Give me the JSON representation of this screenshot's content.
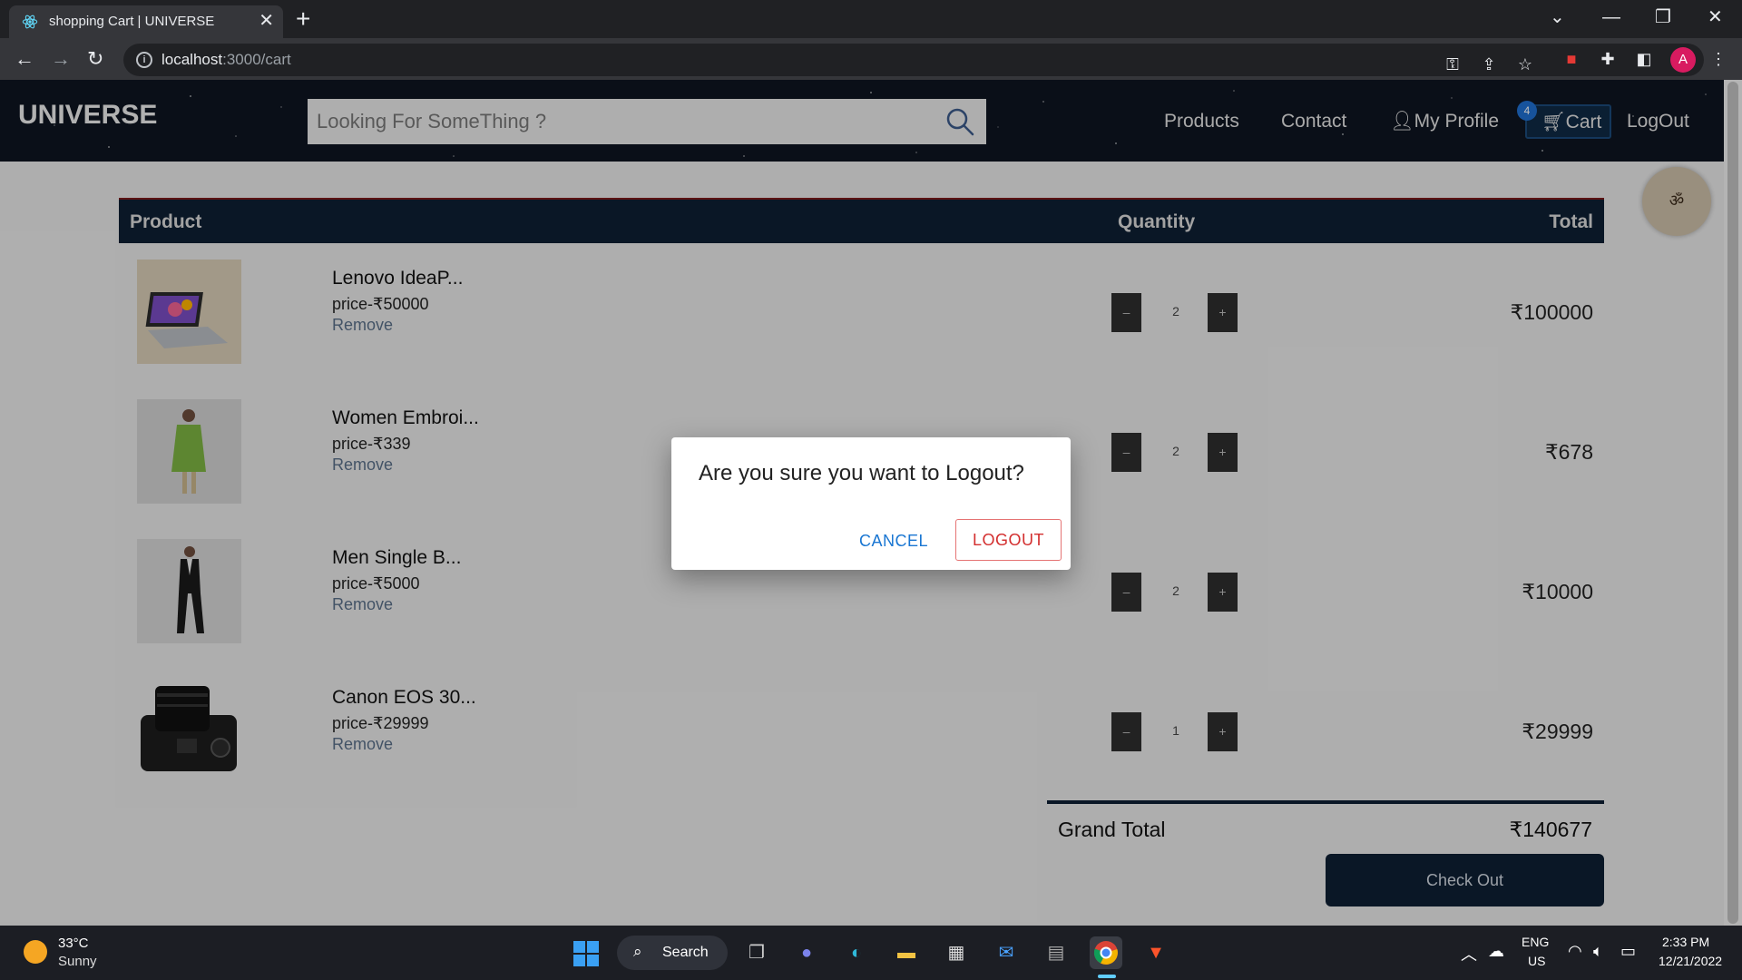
{
  "browser": {
    "tab_title": "shopping Cart | UNIVERSE",
    "tab_close": "✕",
    "new_tab": "+",
    "url_host": "localhost",
    "url_path": ":3000/cart",
    "profile_initial": "A"
  },
  "header": {
    "brand": "UNIVERSE",
    "search_placeholder": "Looking For SomeThing ?",
    "nav": {
      "products": "Products",
      "contact": "Contact",
      "profile": "My Profile",
      "cart": "Cart",
      "cart_count": "4",
      "logout": "LogOut"
    }
  },
  "cart": {
    "columns": {
      "product": "Product",
      "quantity": "Quantity",
      "total": "Total"
    },
    "minus": "–",
    "plus": "+",
    "remove_label": "Remove",
    "items": [
      {
        "name": "Lenovo IdeaP...",
        "price": "price-₹50000",
        "quantity": "2",
        "total": "₹100000"
      },
      {
        "name": "Women Embroi...",
        "price": "price-₹339",
        "quantity": "2",
        "total": "₹678"
      },
      {
        "name": "Men Single B...",
        "price": "price-₹5000",
        "quantity": "2",
        "total": "₹10000"
      },
      {
        "name": "Canon EOS 30...",
        "price": "price-₹29999",
        "quantity": "1",
        "total": "₹29999"
      }
    ],
    "grand_total_label": "Grand Total",
    "grand_total_value": "₹140677",
    "checkout_label": "Check Out"
  },
  "modal": {
    "title": "Are you sure you want to Logout?",
    "cancel": "CANCEL",
    "logout": "LOGOUT"
  },
  "taskbar": {
    "weather_temp": "33°C",
    "weather_desc": "Sunny",
    "search_label": "Search",
    "lang_top": "ENG",
    "lang_bottom": "US",
    "time": "2:33 PM",
    "date": "12/21/2022"
  },
  "colors": {
    "header_bg": "#0e1420",
    "table_head_bg": "#0e1f33",
    "modal_cancel": "#1976d2",
    "modal_logout": "#d32f2f",
    "remove_link": "#5a6f89"
  }
}
